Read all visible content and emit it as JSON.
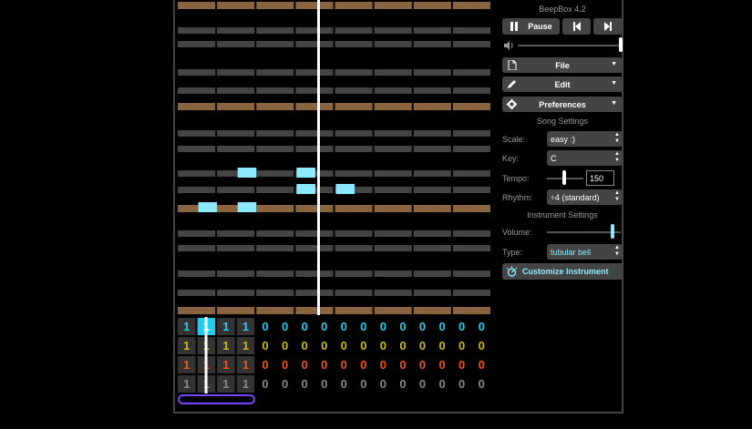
{
  "app": {
    "version": "BeepBox 4.2",
    "colors": {
      "background": "#000000",
      "row": "#444444",
      "octave_row": "#8a6440",
      "note": "#8be9ff",
      "playhead": "#ffffff",
      "channel_colors": [
        "#22ccee",
        "#ccbb11",
        "#ee5511",
        "#888888"
      ],
      "loop": "#7744ff"
    }
  },
  "transport": {
    "pause_label": "Pause"
  },
  "menus": {
    "file": "File",
    "edit": "Edit",
    "preferences": "Preferences"
  },
  "song_settings": {
    "title": "Song Settings",
    "scale_label": "Scale:",
    "scale_value": "easy :)",
    "key_label": "Key:",
    "key_value": "C",
    "tempo_label": "Tempo:",
    "tempo_value": "150",
    "rhythm_label": "Rhythm:",
    "rhythm_value": "÷4 (standard)"
  },
  "instrument_settings": {
    "title": "Instrument Settings",
    "volume_label": "Volume:",
    "type_label": "Type:",
    "type_value": "tubular bell",
    "customize_label": "Customize Instrument"
  },
  "piano_roll": {
    "bars": 8,
    "rows": [
      {
        "octave": true
      },
      {
        "octave": false
      },
      {
        "octave": false
      },
      {
        "octave": false
      },
      {
        "octave": false
      },
      {
        "octave": true
      },
      {
        "octave": false
      },
      {
        "octave": false
      },
      {
        "octave": false
      },
      {
        "octave": false
      },
      {
        "octave": true
      },
      {
        "octave": false
      },
      {
        "octave": false
      },
      {
        "octave": false
      },
      {
        "octave": false
      },
      {
        "octave": true
      }
    ],
    "notes": [
      {
        "row": 8,
        "step": 3
      },
      {
        "row": 8,
        "step": 6
      },
      {
        "row": 9,
        "step": 6
      },
      {
        "row": 9,
        "step": 8
      },
      {
        "row": 10,
        "step": 1
      },
      {
        "row": 10,
        "step": 3
      }
    ],
    "steps_per_bar": 2
  },
  "pattern_grid": {
    "channels": [
      {
        "values": [
          "1",
          "1",
          "1",
          "1",
          "0",
          "0",
          "0",
          "0",
          "0",
          "0",
          "0",
          "0",
          "0",
          "0",
          "0",
          "0"
        ]
      },
      {
        "values": [
          "1",
          "1",
          "1",
          "1",
          "0",
          "0",
          "0",
          "0",
          "0",
          "0",
          "0",
          "0",
          "0",
          "0",
          "0",
          "0"
        ]
      },
      {
        "values": [
          "1",
          "1",
          "1",
          "1",
          "0",
          "0",
          "0",
          "0",
          "0",
          "0",
          "0",
          "0",
          "0",
          "0",
          "0",
          "0"
        ]
      },
      {
        "values": [
          "1",
          "1",
          "1",
          "1",
          "0",
          "0",
          "0",
          "0",
          "0",
          "0",
          "0",
          "0",
          "0",
          "0",
          "0",
          "0"
        ]
      }
    ],
    "selected_bar": 1
  },
  "mixer": {
    "master_volume": 1.0,
    "tempo_slider": 0.45,
    "instrument_volume": 1.0
  }
}
